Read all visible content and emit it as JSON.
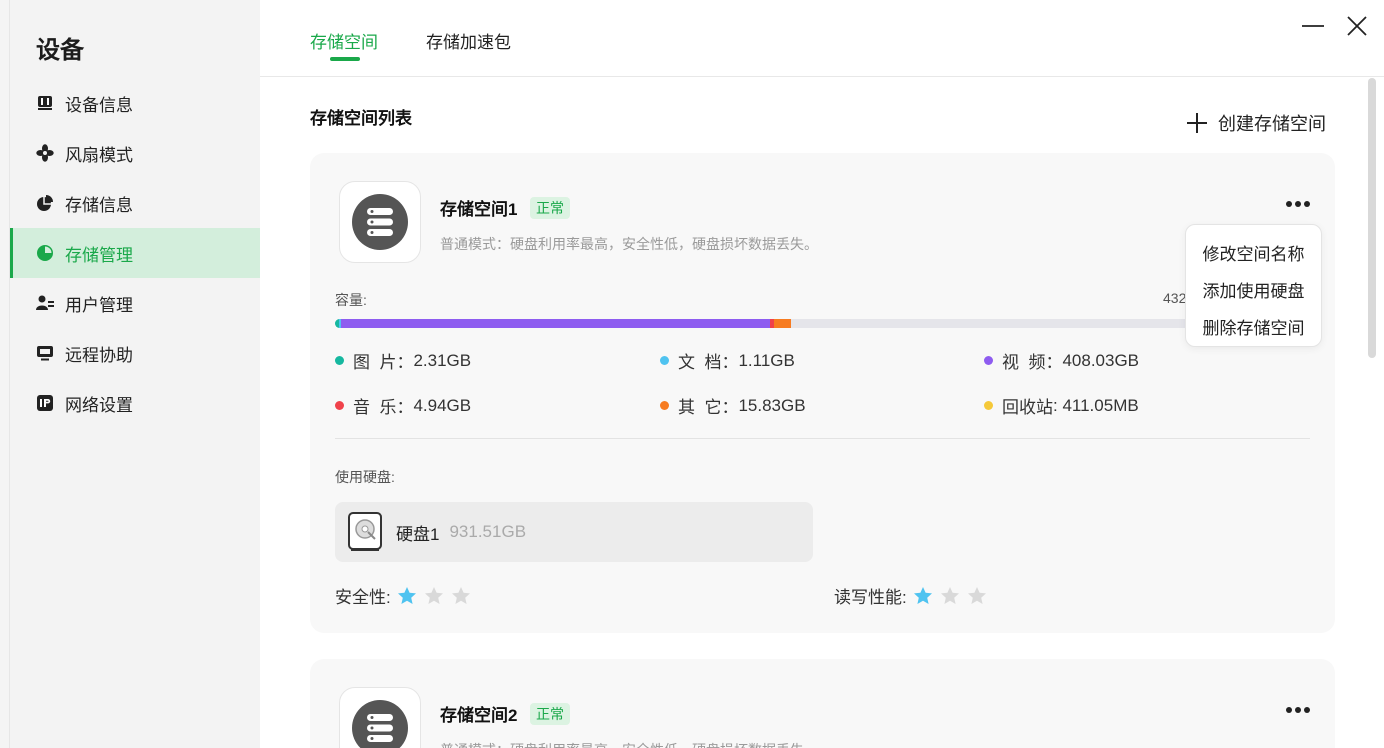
{
  "window": {
    "minimize_icon": "minimize-icon",
    "close_icon": "close-icon"
  },
  "sidebar": {
    "title": "设备",
    "items": [
      {
        "label": "设备信息",
        "icon": "device-info-icon"
      },
      {
        "label": "风扇模式",
        "icon": "fan-icon"
      },
      {
        "label": "存储信息",
        "icon": "storage-info-icon"
      },
      {
        "label": "存储管理",
        "icon": "storage-manage-icon",
        "active": true
      },
      {
        "label": "用户管理",
        "icon": "user-manage-icon"
      },
      {
        "label": "远程协助",
        "icon": "remote-assist-icon"
      },
      {
        "label": "网络设置",
        "icon": "network-ip-icon"
      }
    ]
  },
  "tabs": [
    {
      "label": "存储空间",
      "active": true
    },
    {
      "label": "存储加速包",
      "active": false
    }
  ],
  "list": {
    "title": "存储空间列表",
    "create_label": "创建存储空间"
  },
  "spaces": [
    {
      "name": "存储空间1",
      "status": "正常",
      "description": "普通模式：硬盘利用率最高，安全性低，硬盘损坏数据丢失。",
      "capacity_label": "容量:",
      "capacity_total_partial": "432",
      "usage_bar_fractions": {
        "pictures": 0.004,
        "documents": 0.002,
        "video": 0.44,
        "music": 0.004,
        "other": 0.018
      },
      "legend": [
        {
          "key": "图  片",
          "sep": "：",
          "value": "2.31GB",
          "color": "#16b8a0"
        },
        {
          "key": "文  档",
          "sep": "：",
          "value": "1.11GB",
          "color": "#4fc3f0"
        },
        {
          "key": "视  频",
          "sep": "：",
          "value": "408.03GB",
          "color": "#8e5cf0"
        },
        {
          "key": "音  乐",
          "sep": "：",
          "value": "4.94GB",
          "color": "#f0424b"
        },
        {
          "key": "其  它",
          "sep": "：",
          "value": "15.83GB",
          "color": "#f77c21"
        },
        {
          "key": "回收站",
          "sep": ": ",
          "value": "411.05MB",
          "color": "#f5c93a"
        }
      ],
      "disks_label": "使用硬盘:",
      "disks": [
        {
          "name": "硬盘1",
          "size": "931.51GB"
        }
      ],
      "safety_label": "安全性:",
      "safety_stars": 1,
      "performance_label": "读写性能:",
      "performance_stars": 1
    },
    {
      "name": "存储空间2",
      "status": "正常",
      "description": "普通模式：硬盘利用率最高，安全性低，硬盘损坏数据丢失。"
    }
  ],
  "context_menu": {
    "items": [
      "修改空间名称",
      "添加使用硬盘",
      "删除存储空间"
    ]
  },
  "colors": {
    "accent": "#1aa84a",
    "star_on": "#4fc3f0",
    "star_off": "#d9d9d9"
  }
}
